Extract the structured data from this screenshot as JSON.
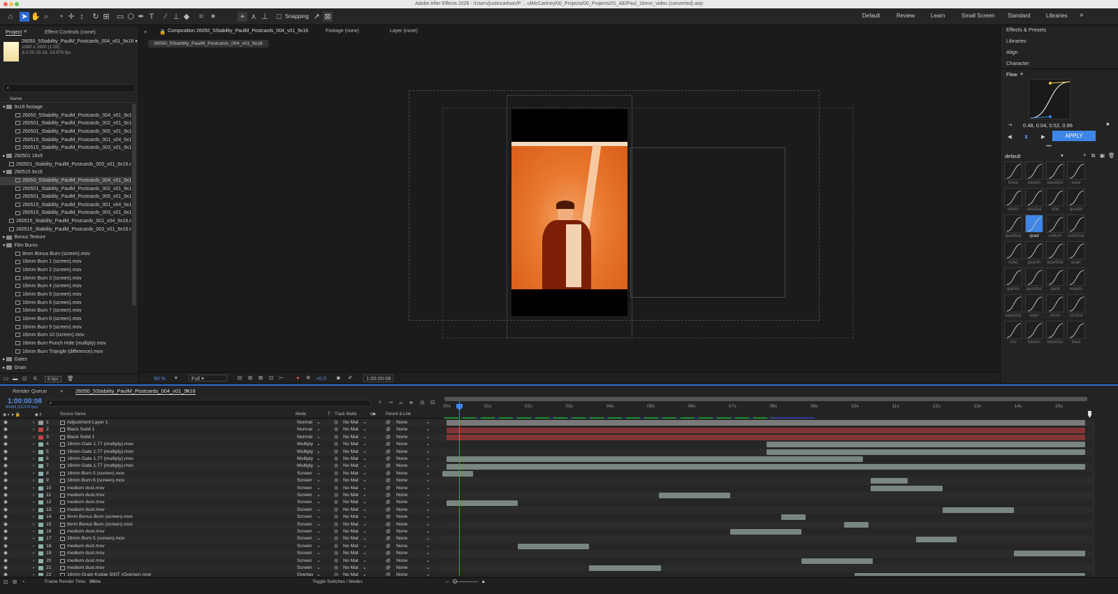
{
  "window": {
    "title": "Adobe After Effects 2026 - /Users/justincarlson/P ... ulMcCartney/00_Projects/00_Projects/01_AE/Paul_16mm_video (converted).aep"
  },
  "toolbar": {
    "snapping_label": "Snapping",
    "workspaces": [
      "Default",
      "Review",
      "Learn",
      "Small Screen",
      "Standard",
      "Libraries"
    ],
    "more_label": "»"
  },
  "project_panel": {
    "tab_project": "Project",
    "tab_effect_controls": "Effect Controls (none)",
    "selected_name": "26050_5Stability_PaulM_Postcards_004_v01_9x16 ▾",
    "selected_dims": "1080 x 1920 (1.00)",
    "selected_duration": "Δ 0:00:15:16, 23.976 fps",
    "search_placeholder": "",
    "column_name": "Name",
    "bpc": "8 bpc",
    "tree": [
      {
        "label": "9x16 footage",
        "type": "folder",
        "indent": 0,
        "open": true
      },
      {
        "label": "26050_5Stability_PaulM_Postcards_004_v01_9x16",
        "type": "comp",
        "indent": 2
      },
      {
        "label": "260501_Stability_PaulM_Postcards_002_v01_9x16",
        "type": "comp",
        "indent": 2
      },
      {
        "label": "260501_Stability_PaulM_Postcards_005_v01_9x16",
        "type": "comp",
        "indent": 2
      },
      {
        "label": "260515_Stability_PaulM_Postcards_001_v04_9x16",
        "type": "comp",
        "indent": 2
      },
      {
        "label": "260515_Stability_PaulM_Postcards_003_v01_9x16",
        "type": "comp",
        "indent": 2
      },
      {
        "label": "260501 16x9",
        "type": "folder",
        "indent": 0,
        "open": false
      },
      {
        "label": "260501_Stability_PaulM_Postcards_005_v01_9x16.mp",
        "type": "file",
        "indent": 1
      },
      {
        "label": "260515 9x16",
        "type": "folder",
        "indent": 0,
        "open": true
      },
      {
        "label": "26050_5Stability_PaulM_Postcards_004_v01_9x16",
        "type": "comp",
        "indent": 2,
        "selected": true
      },
      {
        "label": "260501_Stability_PaulM_Postcards_002_v01_9x16",
        "type": "comp",
        "indent": 2
      },
      {
        "label": "260501_Stability_PaulM_Postcards_005_v01_9x16",
        "type": "comp",
        "indent": 2
      },
      {
        "label": "260515_Stability_PaulM_Postcards_001_v04_9x16",
        "type": "comp",
        "indent": 2
      },
      {
        "label": "260515_Stability_PaulM_Postcards_003_v01_9x16",
        "type": "comp",
        "indent": 2
      },
      {
        "label": "260515_Stability_PaulM_Postcards_001_v04_9x16.mp",
        "type": "file",
        "indent": 1
      },
      {
        "label": "260515_Stability_PaulM_Postcards_003_v01_9x16.mp",
        "type": "file",
        "indent": 1
      },
      {
        "label": "Bonus Texture",
        "type": "folder",
        "indent": 0,
        "open": false
      },
      {
        "label": "Film Burns",
        "type": "folder",
        "indent": 0,
        "open": true
      },
      {
        "label": "8mm Bonus Burn (screen).mov",
        "type": "file",
        "indent": 2
      },
      {
        "label": "16mm Burn 1 (screen).mov",
        "type": "file",
        "indent": 2
      },
      {
        "label": "16mm Burn 2 (screen).mov",
        "type": "file",
        "indent": 2
      },
      {
        "label": "16mm Burn 3 (screen).mov",
        "type": "file",
        "indent": 2
      },
      {
        "label": "16mm Burn 4 (screen).mov",
        "type": "file",
        "indent": 2
      },
      {
        "label": "16mm Burn 5 (screen).mov",
        "type": "file",
        "indent": 2
      },
      {
        "label": "16mm Burn 6 (screen).mov",
        "type": "file",
        "indent": 2
      },
      {
        "label": "16mm Burn 7 (screen).mov",
        "type": "file",
        "indent": 2
      },
      {
        "label": "16mm Burn 8 (screen).mov",
        "type": "file",
        "indent": 2
      },
      {
        "label": "16mm Burn 9 (screen).mov",
        "type": "file",
        "indent": 2
      },
      {
        "label": "16mm Burn 10 (screen).mov",
        "type": "file",
        "indent": 2
      },
      {
        "label": "16mm Burn Punch Hole (multiply).mov",
        "type": "file",
        "indent": 2
      },
      {
        "label": "16mm Burn Triangle (difference).mov",
        "type": "file",
        "indent": 2
      },
      {
        "label": "Gates",
        "type": "folder",
        "indent": 0,
        "open": false
      },
      {
        "label": "Grain",
        "type": "folder",
        "indent": 0,
        "open": false
      }
    ]
  },
  "viewer": {
    "tab_composition": "Composition 26050_5Stability_PaulM_Postcards_004_v01_9x16",
    "tab_footage": "Footage (none)",
    "tab_layer": "Layer (none)",
    "breadcrumb": "26050_5Stability_PaulM_Postcards_004_v01_9x16",
    "zoom": "50 %",
    "resolution": "Full",
    "exposure": "+0.0",
    "timecode": "1:00:00:08"
  },
  "right_panel": {
    "items": [
      "Effects & Presets",
      "Libraries",
      "Align",
      "Character"
    ],
    "flow_title": "Flow",
    "bezier_values": "0.48, 0.04, 0.52, 0.96",
    "apply_label": "APPLY",
    "preset_set": "default",
    "presets": [
      "linear",
      "easeIn",
      "easeOut",
      "ease",
      "sineIn",
      "sineOut",
      "sine",
      "quadIn",
      "quadOut",
      "quad",
      "cubicIn",
      "cubicOut",
      "cubic",
      "quartIn",
      "quartOut",
      "quart",
      "quintIn",
      "quintOut",
      "quint",
      "expoIn",
      "expoOut",
      "expo",
      "circIn",
      "circOut",
      "circ",
      "backIn",
      "backOut",
      "back"
    ],
    "selected_preset": "quad",
    "accent": "#3d86e8"
  },
  "timeline": {
    "tab_render_queue": "Render Queue",
    "tab_comp": "26050_5Stability_PaulM_Postcards_004_v01_9x16",
    "timecode": "1:00:00:08",
    "frame_info": "86408 (23.976 fps)",
    "col_source": "Source Name",
    "col_mode": "Mode",
    "col_t": "T",
    "col_track_matte": "Track Matte",
    "col_parent": "Parent & Link",
    "ruler": [
      "00s",
      "01s",
      "02s",
      "03s",
      "04s",
      "05s",
      "06s",
      "07s",
      "08s",
      "09s",
      "10s",
      "11s",
      "12s",
      "13s",
      "14s",
      "15s"
    ],
    "render_time_label": "Frame Render Time:",
    "render_time_value": "98ms",
    "toggle_label": "Toggle Switches / Modes",
    "layers": [
      {
        "n": "1",
        "name": "Adjustment Layer 1",
        "mode": "Normal",
        "matte": "No Mat",
        "parent": "None",
        "color": "#9a9a9a",
        "start": 0,
        "end": 15.65,
        "bar": "#8e8e8e"
      },
      {
        "n": "2",
        "name": "Black Solid 1",
        "mode": "Normal",
        "matte": "No Mat",
        "parent": "None",
        "color": "#c04646",
        "start": 0,
        "end": 15.65,
        "bar": "#9b3838"
      },
      {
        "n": "3",
        "name": "Black Solid 1",
        "mode": "Normal",
        "matte": "No Mat",
        "parent": "None",
        "color": "#c04646",
        "start": 0,
        "end": 15.65,
        "bar": "#9b3838"
      },
      {
        "n": "4",
        "name": "16mm Gate 1.77 (multiply).mov",
        "mode": "Multiply",
        "matte": "No Mat",
        "parent": "None",
        "color": "#8fb0ad",
        "start": 7.85,
        "end": 15.65
      },
      {
        "n": "5",
        "name": "16mm Gate 1.77 (multiply).mov",
        "mode": "Multiply",
        "matte": "No Mat",
        "parent": "None",
        "color": "#8fb0ad",
        "start": 7.85,
        "end": 15.65
      },
      {
        "n": "6",
        "name": "16mm Gate 1.77 (multiply).mov",
        "mode": "Multiply",
        "matte": "No Mat",
        "parent": "None",
        "color": "#8fb0ad",
        "start": 0,
        "end": 10.2
      },
      {
        "n": "7",
        "name": "16mm Gate 1.77 (multiply).mov",
        "mode": "Multiply",
        "matte": "No Mat",
        "parent": "None",
        "color": "#8fb0ad",
        "start": 0,
        "end": 15.65
      },
      {
        "n": "8",
        "name": "16mm Burn 5 (screen).mov",
        "mode": "Screen",
        "matte": "No Mat",
        "parent": "None",
        "color": "#8fb0ad",
        "start": -0.1,
        "end": 0.65
      },
      {
        "n": "9",
        "name": "16mm Burn 6 (screen).mov",
        "mode": "Screen",
        "matte": "No Mat",
        "parent": "None",
        "color": "#8fb0ad",
        "start": 10.4,
        "end": 11.3
      },
      {
        "n": "10",
        "name": "medium dust.mov",
        "mode": "Screen",
        "matte": "No Mat",
        "parent": "None",
        "color": "#8fb0ad",
        "start": 10.4,
        "end": 12.15
      },
      {
        "n": "11",
        "name": "medium dust.mov",
        "mode": "Screen",
        "matte": "No Mat",
        "parent": "None",
        "color": "#8fb0ad",
        "start": 5.2,
        "end": 6.95
      },
      {
        "n": "12",
        "name": "medium dust.mov",
        "mode": "Screen",
        "matte": "No Mat",
        "parent": "None",
        "color": "#8fb0ad",
        "start": 0,
        "end": 1.75
      },
      {
        "n": "13",
        "name": "medium dust.mov",
        "mode": "Screen",
        "matte": "No Mat",
        "parent": "None",
        "color": "#8fb0ad",
        "start": 12.15,
        "end": 13.9
      },
      {
        "n": "14",
        "name": "8mm Bonus Burn (screen).mov",
        "mode": "Screen",
        "matte": "No Mat",
        "parent": "None",
        "color": "#8fb0ad",
        "start": 8.2,
        "end": 8.8
      },
      {
        "n": "15",
        "name": "8mm Bonus Burn (screen).mov",
        "mode": "Screen",
        "matte": "No Mat",
        "parent": "None",
        "color": "#8fb0ad",
        "start": 9.75,
        "end": 10.35
      },
      {
        "n": "16",
        "name": "medium dust.mov",
        "mode": "Screen",
        "matte": "No Mat",
        "parent": "None",
        "color": "#8fb0ad",
        "start": 6.95,
        "end": 8.7
      },
      {
        "n": "17",
        "name": "16mm Burn 5 (screen).mov",
        "mode": "Screen",
        "matte": "No Mat",
        "parent": "None",
        "color": "#8fb0ad",
        "start": 11.5,
        "end": 12.5
      },
      {
        "n": "18",
        "name": "medium dust.mov",
        "mode": "Screen",
        "matte": "No Mat",
        "parent": "None",
        "color": "#8fb0ad",
        "start": 1.75,
        "end": 3.5
      },
      {
        "n": "19",
        "name": "medium dust.mov",
        "mode": "Screen",
        "matte": "No Mat",
        "parent": "None",
        "color": "#8fb0ad",
        "start": 13.9,
        "end": 15.65
      },
      {
        "n": "20",
        "name": "medium dust.mov",
        "mode": "Screen",
        "matte": "No Mat",
        "parent": "None",
        "color": "#8fb0ad",
        "start": 8.7,
        "end": 10.45
      },
      {
        "n": "21",
        "name": "medium dust.mov",
        "mode": "Screen",
        "matte": "No Mat",
        "parent": "None",
        "color": "#8fb0ad",
        "start": 3.5,
        "end": 5.25
      },
      {
        "n": "22",
        "name": "16mm Grain Kodak 500T (Overlay).mov",
        "mode": "Overlay",
        "matte": "No Mat",
        "parent": "None",
        "color": "#8fb0ad",
        "start": 10.0,
        "end": 15.65
      }
    ]
  }
}
